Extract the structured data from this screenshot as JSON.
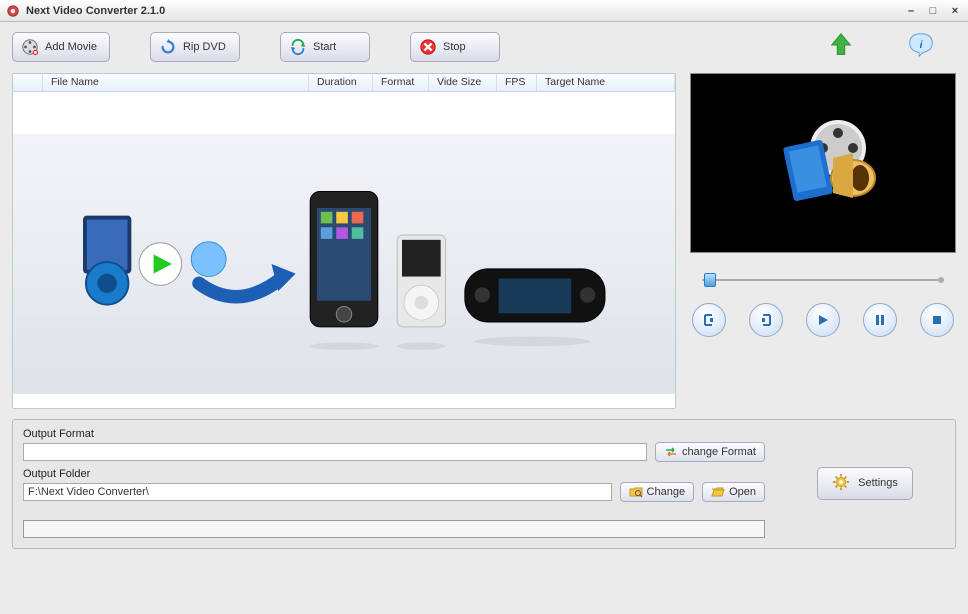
{
  "window": {
    "title": "Next Video Converter 2.1.0"
  },
  "toolbar": {
    "add_movie": "Add Movie",
    "rip_dvd": "Rip DVD",
    "start": "Start",
    "stop": "Stop"
  },
  "file_table": {
    "columns": {
      "file_name": "File Name",
      "duration": "Duration",
      "format": "Format",
      "video_size": "Vide Size",
      "fps": "FPS",
      "target_name": "Target Name"
    }
  },
  "player": {
    "mark_in": "mark-in",
    "mark_out": "mark-out",
    "play": "play",
    "pause": "pause",
    "stop": "stop"
  },
  "output": {
    "format_label": "Output Format",
    "format_value": "",
    "change_format": "change Format",
    "folder_label": "Output Folder",
    "folder_value": "F:\\Next Video Converter\\",
    "change": "Change",
    "open": "Open"
  },
  "settings_btn": "Settings"
}
